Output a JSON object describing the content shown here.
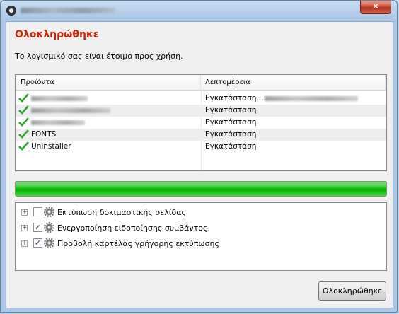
{
  "window": {
    "close_label": "✕"
  },
  "header": {
    "title": "Ολοκληρώθηκε",
    "subtitle": "Το λογισμικό σας είναι έτοιμο προς χρήση."
  },
  "list": {
    "columns": [
      "Προϊόντα",
      "Λεπτομέρεια"
    ],
    "rows": [
      {
        "product": "",
        "detail": "Εγκατάσταση..."
      },
      {
        "product": "",
        "detail": "Εγκατάσταση"
      },
      {
        "product": "",
        "detail": "Εγκατάσταση"
      },
      {
        "product": "FONTS",
        "detail": "Εγκατάσταση"
      },
      {
        "product": "Uninstaller",
        "detail": "Εγκατάσταση"
      }
    ]
  },
  "progress": {
    "value": 1.0,
    "color": "#06b006"
  },
  "options": [
    {
      "label": "Εκτύπωση δοκιμαστικής σελίδας",
      "checked": false
    },
    {
      "label": "Ενεργοποίηση ειδοποίησης συμβάντος",
      "checked": true
    },
    {
      "label": "Προβολή καρτέλας γρήγορης εκτύπωσης",
      "checked": true
    }
  ],
  "footer": {
    "finish_label": "Ολοκληρώθηκε"
  },
  "colors": {
    "heading": "#cc2200",
    "check": "#2aa52a"
  },
  "icons": {
    "check": "check-icon",
    "gear": "gear-icon",
    "expand": "expand-icon"
  }
}
